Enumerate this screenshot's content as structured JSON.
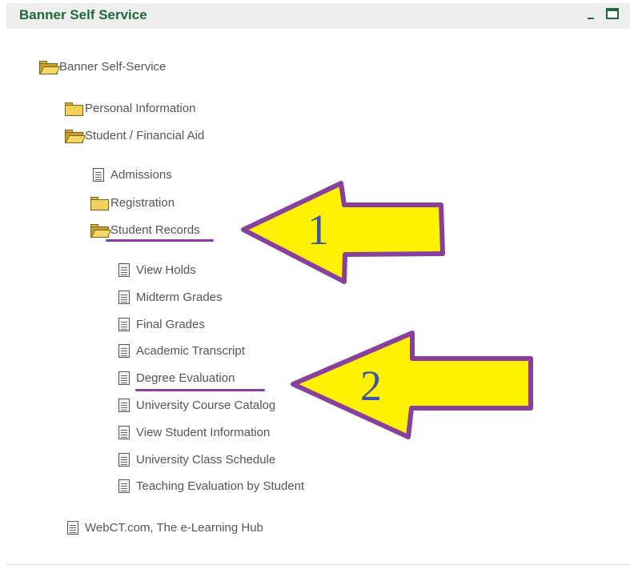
{
  "header": {
    "title": "Banner Self Service"
  },
  "tree": {
    "root": "Banner Self-Service",
    "personal_information": "Personal Information",
    "student_financial_aid": "Student / Financial Aid",
    "admissions": "Admissions",
    "registration": "Registration",
    "student_records": "Student Records",
    "records_items": [
      "View Holds",
      "Midterm Grades",
      "Final Grades",
      "Academic Transcript",
      "Degree Evaluation",
      "University Course Catalog",
      "View Student Information",
      "University Class Schedule",
      "Teaching Evaluation by Student"
    ],
    "webct": "WebCT.com, The e-Learning Hub"
  },
  "annotations": {
    "arrow1_number": "1",
    "arrow2_number": "2"
  },
  "colors": {
    "header_title": "#1e6a3c",
    "arrow_fill": "#fff200",
    "arrow_outline": "#8a3f9e",
    "arrow_number": "#3d56a8"
  }
}
